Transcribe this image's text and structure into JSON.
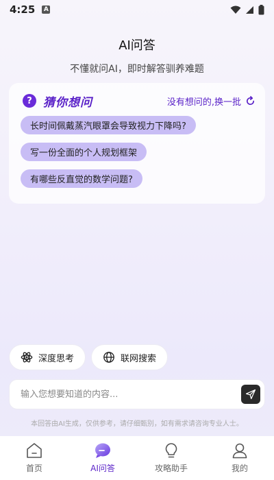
{
  "status": {
    "time": "4:25",
    "notif_badge": "A"
  },
  "header": {
    "title": "AI问答",
    "subtitle": "不懂就问AI，即时解答驯养难题"
  },
  "suggest": {
    "title": "猜你想问",
    "icon": "question-icon",
    "refresh_label": "没有想问的,换一批",
    "questions": [
      "长时间佩戴蒸汽眼罩会导致视力下降吗?",
      "写一份全面的个人规划框架",
      "有哪些反直觉的数学问题?"
    ]
  },
  "modes": {
    "deep_think": "深度思考",
    "web_search": "联网搜索"
  },
  "input": {
    "placeholder": "输入您想要知道的内容...",
    "value": ""
  },
  "disclaimer": "本回答由AI生成，仅供参考，请仔细甄别，如有需求请咨询专业人士。",
  "tabs": [
    {
      "label": "首页",
      "icon": "home-icon"
    },
    {
      "label": "AI问答",
      "icon": "chat-bubble-icon",
      "active": true
    },
    {
      "label": "攻略助手",
      "icon": "lightbulb-icon"
    },
    {
      "label": "我的",
      "icon": "user-icon"
    }
  ],
  "colors": {
    "accent": "#5a22c8",
    "pill": "#c8bdf5",
    "send": "#2a2a2a"
  }
}
